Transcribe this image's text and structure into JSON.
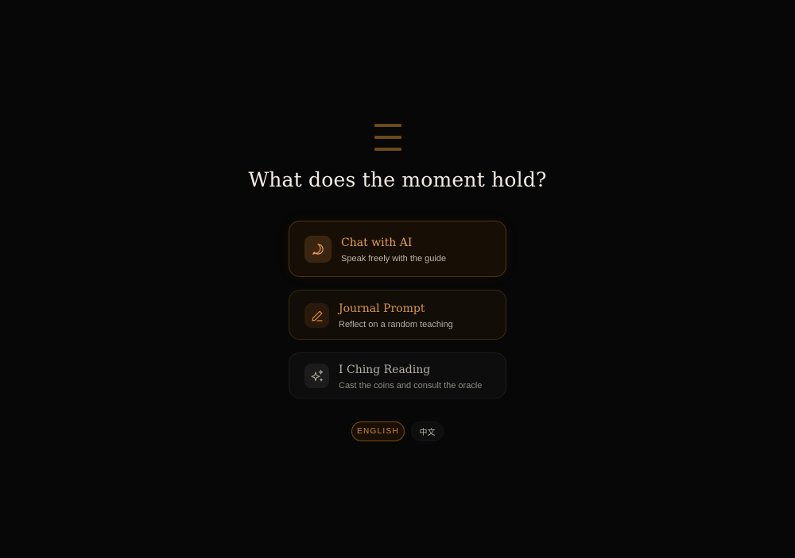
{
  "header": {
    "title": "What does the moment hold?",
    "logo_icon": "hexagram-lines-icon"
  },
  "options": {
    "chat": {
      "title": "Chat with AI",
      "subtitle": "Speak freely with the guide",
      "icon": "chat-bubble-icon"
    },
    "journal": {
      "title": "Journal Prompt",
      "subtitle": "Reflect on a random teaching",
      "icon": "pen-icon"
    },
    "iching": {
      "title": "I Ching Reading",
      "subtitle": "Cast the coins and consult the oracle",
      "icon": "sparkles-icon"
    }
  },
  "language": {
    "english_label": "ENGLISH",
    "chinese_label": "中文",
    "selected": "ENGLISH"
  },
  "colors": {
    "background": "#070707",
    "accent": "#e7a052"
  }
}
